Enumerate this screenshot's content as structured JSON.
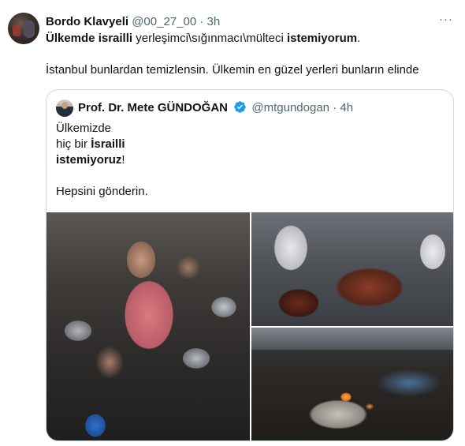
{
  "tweet": {
    "author_name": "Bordo Klavyeli",
    "handle": "@00_27_00",
    "separator": "·",
    "time": "3h",
    "more_label": "···",
    "text": {
      "bold1": "Ülkemde israilli",
      "normal1": " yerleşimci\\sığınmacı\\mülteci ",
      "bold2": "istemiyorum",
      "normal2": ".",
      "line2": "İstanbul bunlardan temizlensin. Ülkemin en güzel yerleri bunların elinde"
    }
  },
  "quote": {
    "author_name": "Prof. Dr. Mete GÜNDOĞAN",
    "verified": true,
    "handle": "@mtgundogan",
    "separator": "·",
    "time": "4h",
    "line1": "Ülkemizde",
    "line2_normal": "hiç bir ",
    "line2_bold": "İsrailli",
    "line3_bold": "istemiyoruz",
    "line3_normal": "!",
    "line4": "Hepsini gönderin."
  },
  "media": [
    {
      "icon": "photo-crowd-children"
    },
    {
      "icon": "photo-injured-child"
    },
    {
      "icon": "photo-burning-debris"
    }
  ],
  "colors": {
    "text": "#0f1419",
    "secondary": "#536471",
    "border": "#cfd9de",
    "verified": "#1d9bf0"
  }
}
